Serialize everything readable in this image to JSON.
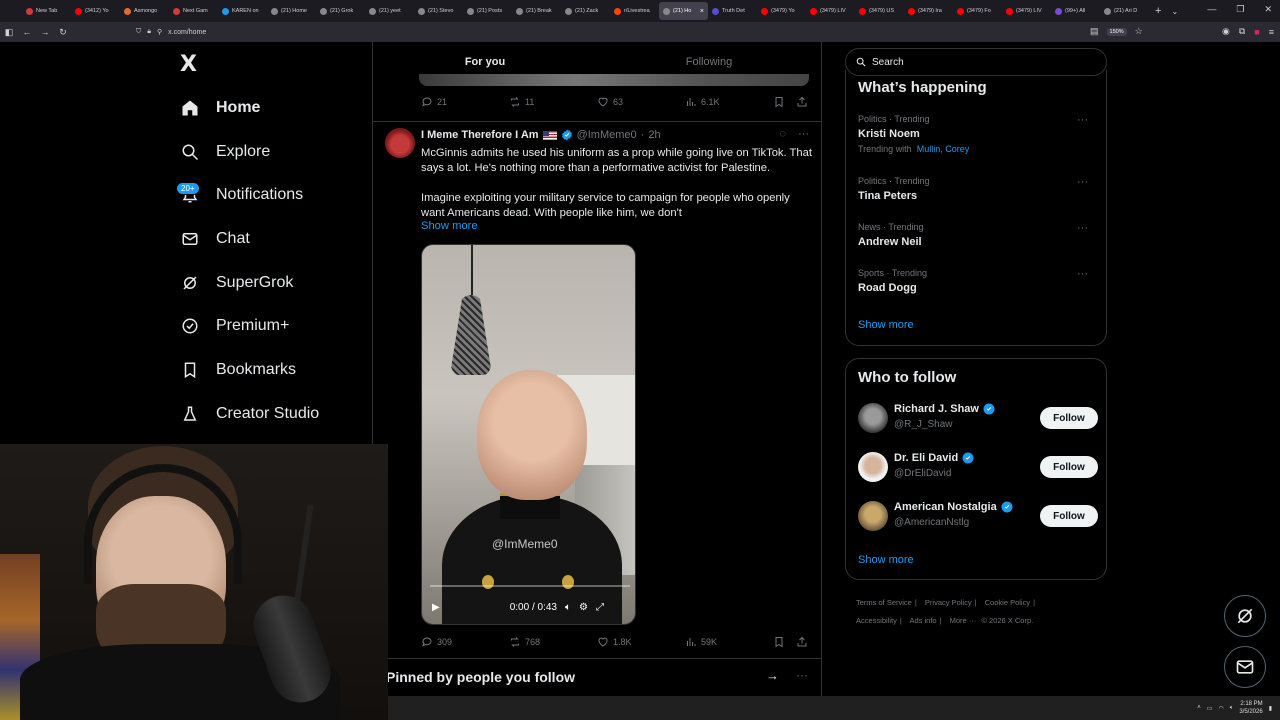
{
  "browser": {
    "tabs": [
      {
        "label": "New Tab",
        "color": "#d13b3b"
      },
      {
        "label": "(3412) Yo",
        "color": "#ff0000"
      },
      {
        "label": "Asmongo",
        "color": "#e46b28"
      },
      {
        "label": "Next Gam",
        "color": "#d13b3b"
      },
      {
        "label": "KAREN on",
        "color": "#1d9bf0"
      },
      {
        "label": "(21) Home",
        "color": "#888888"
      },
      {
        "label": "(21) Grok",
        "color": "#888888"
      },
      {
        "label": "(21) yeet",
        "color": "#888888"
      },
      {
        "label": "(21) Stevo",
        "color": "#888888"
      },
      {
        "label": "(21) Posts",
        "color": "#888888"
      },
      {
        "label": "(21) Break",
        "color": "#888888"
      },
      {
        "label": "(21) Zack",
        "color": "#888888"
      },
      {
        "label": "r/Livestrea",
        "color": "#ff4500"
      },
      {
        "label": "(21) Ho",
        "color": "#888888",
        "active": true
      },
      {
        "label": "Truth Det",
        "color": "#5a4bd1"
      },
      {
        "label": "(3479) Yo",
        "color": "#ff0000"
      },
      {
        "label": "(3479) LIV",
        "color": "#ff0000"
      },
      {
        "label": "(3479) US",
        "color": "#ff0000"
      },
      {
        "label": "(3479) Ira",
        "color": "#ff0000"
      },
      {
        "label": "(3479) Fo",
        "color": "#ff0000"
      },
      {
        "label": "(3479) LIV",
        "color": "#ff0000"
      },
      {
        "label": "(99+) All",
        "color": "#7b4bd1"
      },
      {
        "label": "(21) Ari D",
        "color": "#888888"
      }
    ],
    "url": "x.com/home",
    "zoom": "150%"
  },
  "sidebar": {
    "logo": "X",
    "items": [
      {
        "label": "Home",
        "icon": "home-icon"
      },
      {
        "label": "Explore",
        "icon": "search-icon"
      },
      {
        "label": "Notifications",
        "icon": "bell-icon",
        "badge": "20+"
      },
      {
        "label": "Chat",
        "icon": "mail-icon"
      },
      {
        "label": "SuperGrok",
        "icon": "grok-icon"
      },
      {
        "label": "Premium+",
        "icon": "verified-icon"
      },
      {
        "label": "Bookmarks",
        "icon": "bookmark-icon"
      },
      {
        "label": "Creator Studio",
        "icon": "flask-icon"
      }
    ]
  },
  "feed": {
    "tabs": [
      "For you",
      "Following"
    ],
    "prev_post_actions": {
      "replies": "21",
      "reposts": "11",
      "likes": "63",
      "views": "6.1K"
    },
    "post": {
      "name": "I Meme Therefore I Am",
      "handle": "@ImMeme0",
      "time": "2h",
      "text1": "McGinnis admits he used his uniform as a prop while going live on TikTok. That says a lot. He's nothing more than a performative activist for Palestine.",
      "text2": "Imagine exploiting your military service to campaign for people who openly want Americans dead. With people like him, we don't",
      "show_more": "Show more",
      "video": {
        "watermark": "@ImMeme0",
        "time": "0:00 / 0:43",
        "progress": 0
      },
      "actions": {
        "replies": "309",
        "reposts": "768",
        "likes": "1.8K",
        "views": "59K"
      }
    },
    "pinned_title": "Pinned by people you follow"
  },
  "right": {
    "search_placeholder": "Search",
    "trending_title": "What’s happening",
    "trends": [
      {
        "category": "Politics · Trending",
        "topic": "Kristi Noem",
        "with_label": "Trending with",
        "with_links": "Mullin, Corey"
      },
      {
        "category": "Politics · Trending",
        "topic": "Tina Peters"
      },
      {
        "category": "News · Trending",
        "topic": "Andrew Neil"
      },
      {
        "category": "Sports · Trending",
        "topic": "Road Dogg"
      }
    ],
    "show_more": "Show more",
    "who_title": "Who to follow",
    "follow": [
      {
        "name": "Richard J. Shaw",
        "handle": "@R_J_Shaw",
        "button": "Follow"
      },
      {
        "name": "Dr. Eli David",
        "handle": "@DrEliDavid",
        "button": "Follow"
      },
      {
        "name": "American Nostalgia",
        "handle": "@AmericanNstlg",
        "button": "Follow"
      }
    ],
    "footer": [
      "Terms of Service",
      "Privacy Policy",
      "Cookie Policy",
      "Accessibility",
      "Ads info",
      "More ···",
      "© 2026 X Corp."
    ]
  },
  "taskbar": {
    "time": "2:18 PM",
    "date": "3/5/2026"
  },
  "colors": {
    "accent": "#1d9bf0",
    "background": "#000000",
    "border": "#2f3336",
    "muted": "#71767b"
  }
}
